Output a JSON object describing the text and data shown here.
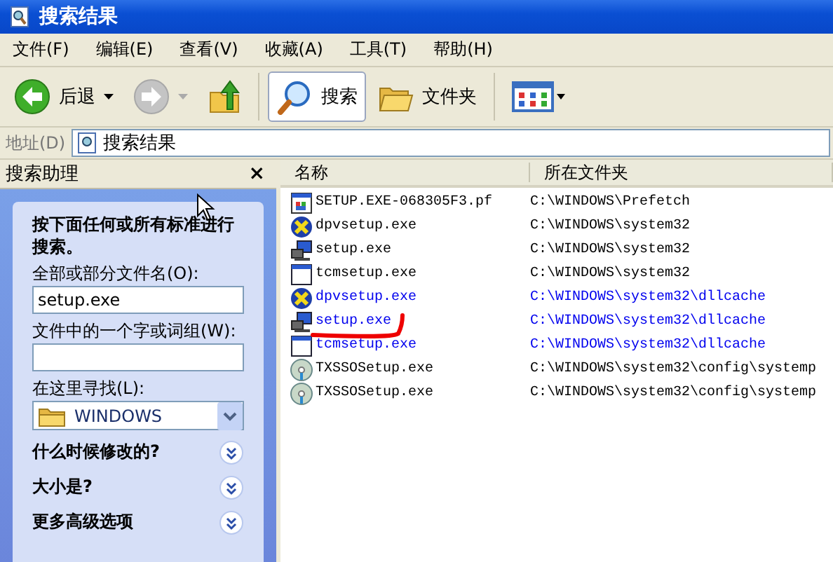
{
  "window": {
    "title": "搜索结果"
  },
  "menu": [
    {
      "label": "文件(F)"
    },
    {
      "label": "编辑(E)"
    },
    {
      "label": "查看(V)"
    },
    {
      "label": "收藏(A)"
    },
    {
      "label": "工具(T)"
    },
    {
      "label": "帮助(H)"
    }
  ],
  "toolbar": [
    {
      "kind": "back",
      "label": "后退",
      "disabled": false
    },
    {
      "kind": "forward",
      "disabled": true
    },
    {
      "kind": "up"
    },
    {
      "kind": "search",
      "label": "搜索",
      "selected": true
    },
    {
      "kind": "folders",
      "label": "文件夹",
      "selected": false
    },
    {
      "kind": "views"
    }
  ],
  "address": {
    "label": "地址(D)",
    "value": "搜索结果"
  },
  "search_pane": {
    "title": "搜索助理",
    "close": "×",
    "instruction": "按下面任何或所有标准进行搜索。",
    "name_label": "全部或部分文件名(O):",
    "name_value": "setup.exe",
    "word_label": "文件中的一个字或词组(W):",
    "location_label": "在这里寻找(L):",
    "location_value": "WINDOWS",
    "sections": [
      "什么时候修改的?",
      "大小是?",
      "更多高级选项"
    ]
  },
  "results": {
    "columns": [
      "名称",
      "所在文件夹"
    ],
    "rows": [
      {
        "name": "SETUP.EXE-068305F3.pf",
        "folder": "C:\\WINDOWS\\Prefetch",
        "kind": "prefetch",
        "compressed": false
      },
      {
        "name": "dpvsetup.exe",
        "folder": "C:\\WINDOWS\\system32",
        "kind": "directx",
        "compressed": false
      },
      {
        "name": "setup.exe",
        "folder": "C:\\WINDOWS\\system32",
        "kind": "installer",
        "compressed": false
      },
      {
        "name": "tcmsetup.exe",
        "folder": "C:\\WINDOWS\\system32",
        "kind": "program",
        "compressed": false
      },
      {
        "name": "dpvsetup.exe",
        "folder": "C:\\WINDOWS\\system32\\dllcache",
        "kind": "directx",
        "compressed": true
      },
      {
        "name": "setup.exe",
        "folder": "C:\\WINDOWS\\system32\\dllcache",
        "kind": "installer",
        "compressed": true
      },
      {
        "name": "tcmsetup.exe",
        "folder": "C:\\WINDOWS\\system32\\dllcache",
        "kind": "program",
        "compressed": true
      },
      {
        "name": "TXSSOSetup.exe",
        "folder": "C:\\WINDOWS\\system32\\config\\systemp",
        "kind": "disc",
        "compressed": false
      },
      {
        "name": "TXSSOSetup.exe",
        "folder": "C:\\WINDOWS\\system32\\config\\systemp",
        "kind": "disc",
        "compressed": false
      }
    ]
  }
}
